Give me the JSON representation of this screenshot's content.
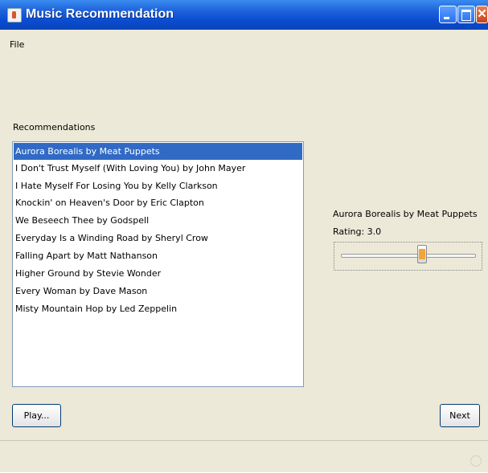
{
  "window": {
    "title": "Music Recommendation"
  },
  "menu": {
    "file": "File"
  },
  "recommendations": {
    "label": "Recommendations",
    "selected_index": 0,
    "items": [
      "Aurora Borealis by Meat Puppets",
      "I Don't Trust Myself (With Loving You) by John Mayer",
      "I Hate Myself For Losing You by Kelly Clarkson",
      "Knockin' on Heaven's Door by Eric Clapton",
      "We Beseech Thee by Godspell",
      "Everyday Is a Winding Road by Sheryl Crow",
      "Falling Apart by Matt Nathanson",
      "Higher Ground by Stevie Wonder",
      "Every Woman by Dave Mason",
      "Misty Mountain Hop by Led Zeppelin"
    ]
  },
  "details": {
    "song": "Aurora Borealis by Meat Puppets",
    "rating_text": "Rating: 3.0",
    "rating_value": 3.0
  },
  "buttons": {
    "play": "Play...",
    "next": "Next"
  },
  "colors": {
    "selection": "#316ac5",
    "titlebar": "#0a4cd0",
    "background": "#ece9d8"
  },
  "icons": [
    "java-app-icon",
    "minimize-icon",
    "maximize-icon",
    "close-icon",
    "resize-grip-icon"
  ]
}
